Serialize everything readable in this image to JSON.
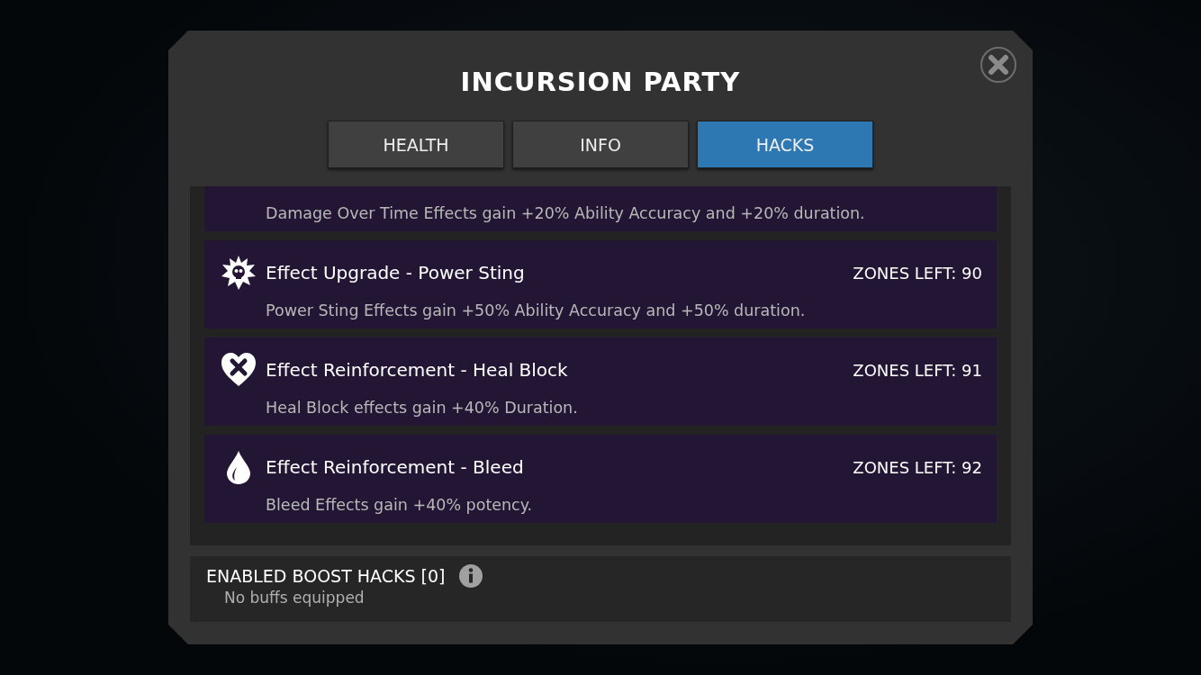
{
  "dialog": {
    "title": "INCURSION PARTY"
  },
  "tabs": [
    {
      "label": "HEALTH",
      "selected": false
    },
    {
      "label": "INFO",
      "selected": false
    },
    {
      "label": "HACKS",
      "selected": true
    }
  ],
  "hacks": [
    {
      "kind": "clipped",
      "description": "Damage Over Time Effects gain +20% Ability Accuracy and +20% duration."
    },
    {
      "kind": "sting",
      "title": "Effect Upgrade - Power Sting",
      "zones_left": "ZONES LEFT: 90",
      "description": "Power Sting Effects gain +50% Ability Accuracy and +50% duration."
    },
    {
      "kind": "heal-block",
      "title": "Effect Reinforcement - Heal Block",
      "zones_left": "ZONES LEFT: 91",
      "description": "Heal Block effects gain +40% Duration."
    },
    {
      "kind": "bleed",
      "title": "Effect Reinforcement - Bleed",
      "zones_left": "ZONES LEFT: 92",
      "description": "Bleed Effects gain +40% potency."
    }
  ],
  "boost": {
    "heading": "ENABLED BOOST HACKS [0]",
    "empty_text": "No buffs equipped"
  }
}
